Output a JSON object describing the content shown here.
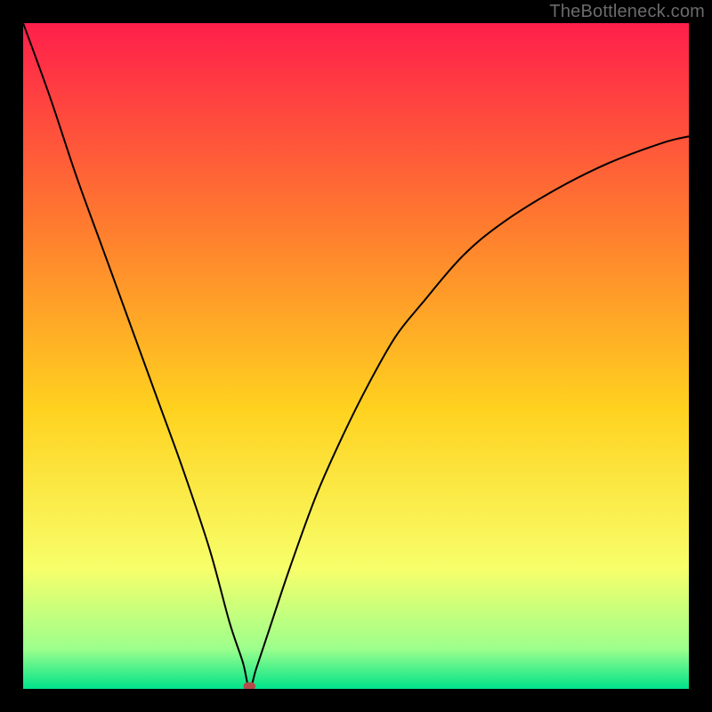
{
  "watermark": "TheBottleneck.com",
  "chart_data": {
    "type": "line",
    "title": "",
    "xlabel": "",
    "ylabel": "",
    "xlim": [
      0,
      100
    ],
    "ylim": [
      0,
      100
    ],
    "grid": false,
    "legend": false,
    "background_gradient": {
      "top": "#ff1f4b",
      "upper_mid": "#ff7a2f",
      "mid": "#ffd21f",
      "lower_mid": "#f7ff6a",
      "near_bottom": "#9cff8c",
      "bottom": "#00e38a"
    },
    "annotations": [
      {
        "name": "bottleneck-marker",
        "x": 34,
        "y": 0,
        "color": "#b44a4a"
      }
    ],
    "series": [
      {
        "name": "bottleneck-curve",
        "color": "#000000",
        "x": [
          0,
          4,
          8,
          12,
          16,
          20,
          24,
          28,
          31,
          33,
          34,
          35,
          37,
          40,
          44,
          48,
          52,
          56,
          60,
          66,
          72,
          80,
          88,
          96,
          100
        ],
        "values": [
          100,
          89,
          77,
          66,
          55,
          44,
          33,
          21,
          10,
          4,
          0,
          3,
          9,
          18,
          29,
          38,
          46,
          53,
          58,
          65,
          70,
          75,
          79,
          82,
          83
        ]
      }
    ]
  }
}
